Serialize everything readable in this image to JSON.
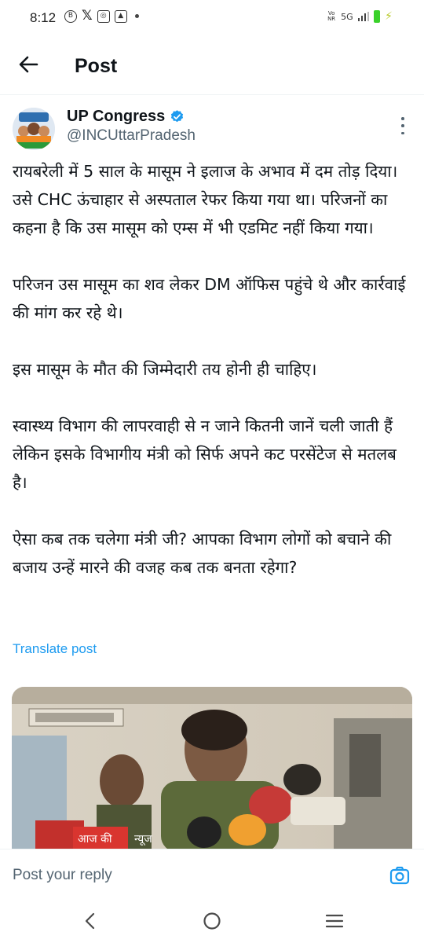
{
  "status_bar": {
    "time": "8:12",
    "network": "5G",
    "volte": "Vo\nNR"
  },
  "header": {
    "title": "Post"
  },
  "post": {
    "author_name": "UP Congress",
    "author_handle": "@INCUttarPradesh",
    "paragraphs": [
      "रायबरेली में 5 साल के मासूम ने इलाज के अभाव में दम तोड़ दिया। उसे CHC ऊंचाहार से अस्पताल रेफर किया गया था। परिजनों का कहना है कि उस मासूम को एम्स में भी एडमिट नहीं किया गया।",
      "परिजन उस मासूम का शव लेकर DM ऑफिस पहुंचे थे और कार्रवाई की मांग कर रहे थे।",
      "इस मासूम के मौत की जिम्मेदारी तय होनी ही चाहिए।",
      "स्वास्थ्य विभाग की लापरवाही से न जाने कितनी जानें चली जाती हैं लेकिन इसके विभागीय मंत्री को सिर्फ अपने कट परसेंटेज से मतलब है।",
      "ऐसा कब तक चलेगा मंत्री जी? आपका विभाग लोगों को बचाने की बजाय उन्हें मारने की वजह कब तक बनता रहेगा?"
    ],
    "translate_label": "Translate post",
    "media_sign_text": "आज की",
    "media_mic_text": "न्यूज"
  },
  "reply": {
    "placeholder": "Post your reply"
  },
  "colors": {
    "accent": "#1d9bf0",
    "secondary_text": "#536471",
    "primary_text": "#0f1419"
  }
}
